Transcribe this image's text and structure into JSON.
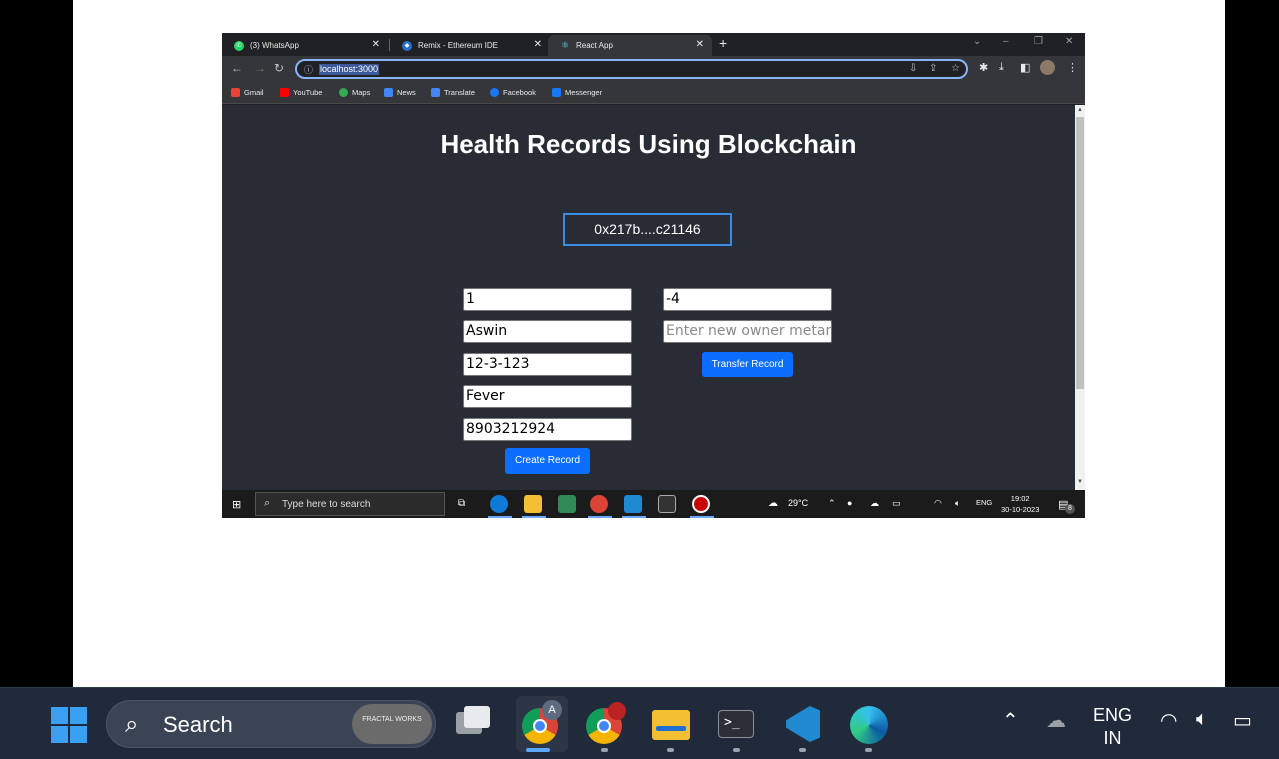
{
  "browser": {
    "tabs": [
      {
        "label": "(3) WhatsApp",
        "icon": "whatsapp-icon"
      },
      {
        "label": "Remix - Ethereum IDE",
        "icon": "remix-icon"
      },
      {
        "label": "React App",
        "icon": "react-icon"
      }
    ],
    "new_tab": "+",
    "url": "localhost:3000",
    "bookmarks": [
      "Gmail",
      "YouTube",
      "Maps",
      "News",
      "Translate",
      "Facebook",
      "Messenger"
    ]
  },
  "page": {
    "title": "Health Records Using Blockchain",
    "account": "0x217b....c21146",
    "create_form": {
      "record_id": "1",
      "name": "Aswin",
      "date": "12-3-123",
      "diagnosis": "Fever",
      "phone": "8903212924",
      "create_label": "Create Record"
    },
    "transfer_form": {
      "record_id": "-4",
      "owner_placeholder": "Enter new owner metamask",
      "transfer_label": "Transfer Record"
    }
  },
  "inner_taskbar": {
    "search_placeholder": "Type here to search",
    "weather": "29°C",
    "lang": "ENG",
    "time": "19:02",
    "date": "30-10-2023",
    "notif_count": "8"
  },
  "taskbar": {
    "search_label": "Search",
    "widget_label": "FRACTAL WORKS",
    "lang_top": "ENG",
    "lang_bottom": "IN",
    "chrome_badge": "A"
  },
  "colors": {
    "accent": "#0d6efd",
    "app_bg": "#282c34",
    "account_border": "#3a8dde"
  }
}
